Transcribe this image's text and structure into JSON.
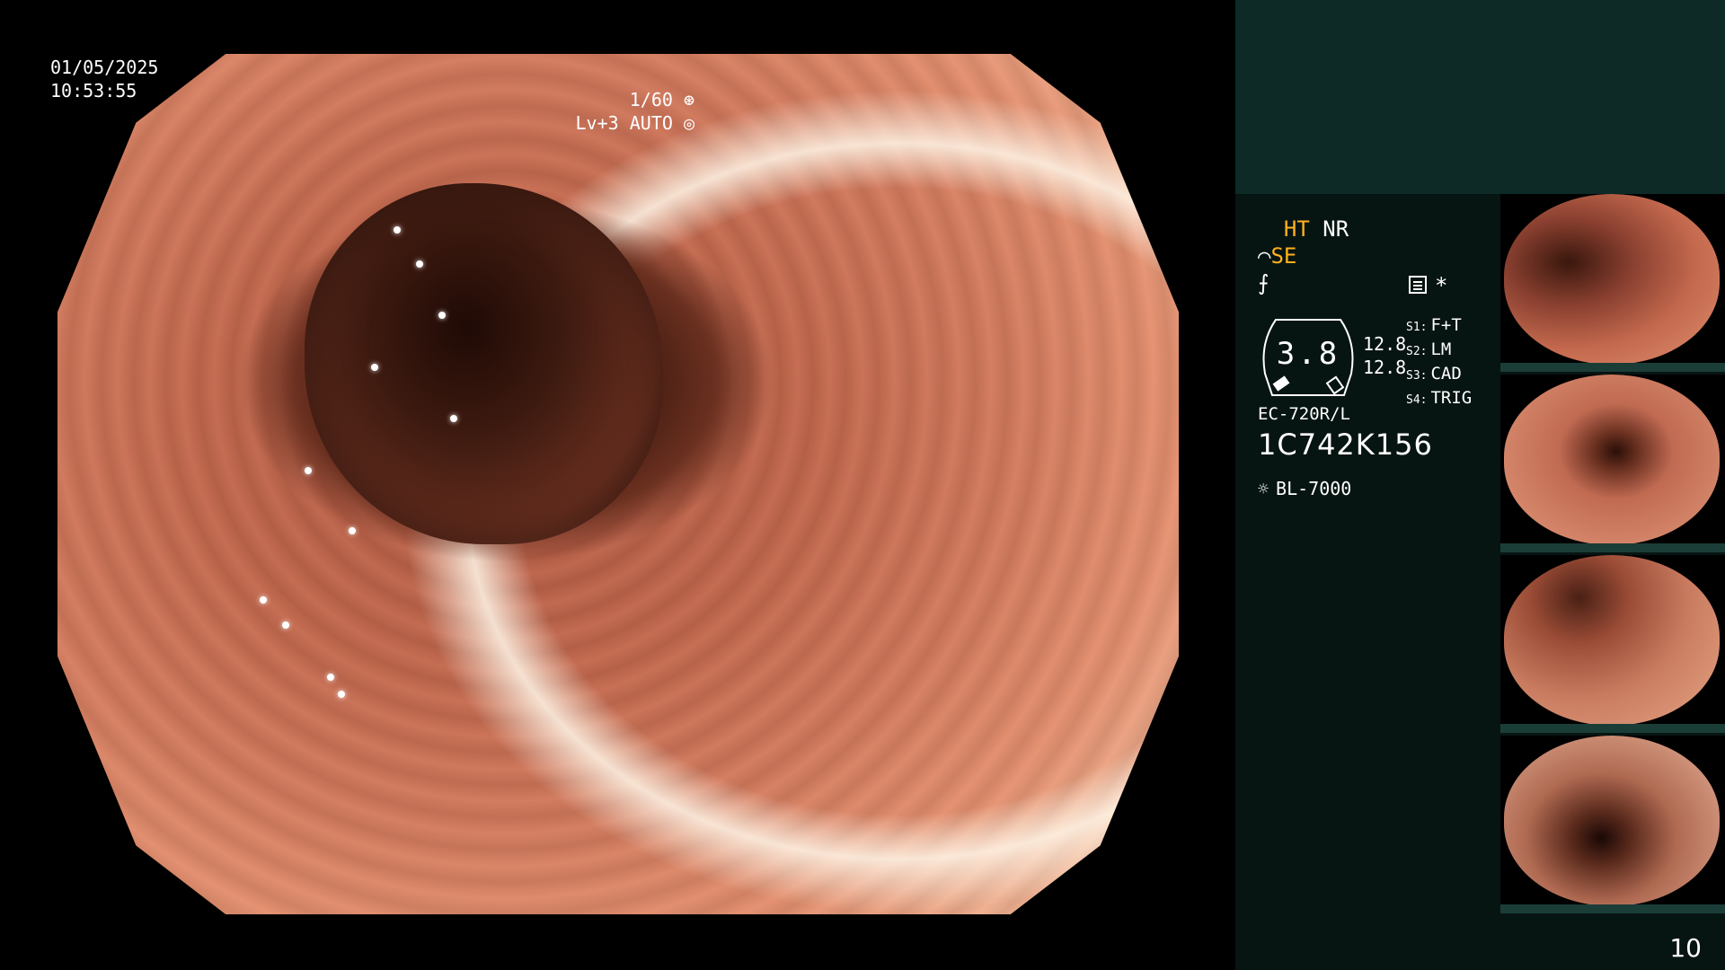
{
  "osd": {
    "date": "01/05/2025",
    "time": "10:53:55",
    "shutter": "1/60",
    "level": "Lv+3",
    "iris": "AUTO"
  },
  "side": {
    "mode_ht": "HT",
    "mode_nr": "NR",
    "mode_se": "SE",
    "dial_value": "3.8",
    "val_top": "12.8",
    "val_bottom": "12.8",
    "sources": [
      {
        "key": "S1:",
        "value": "F+T"
      },
      {
        "key": "S2:",
        "value": "LM"
      },
      {
        "key": "S3:",
        "value": "CAD"
      },
      {
        "key": "S4:",
        "value": "TRIG"
      }
    ],
    "asterisk": "*",
    "scope_model": "EC-720R/L",
    "serial": "1C742K156",
    "light_source": "BL-7000",
    "page_number": "10"
  },
  "colors": {
    "accent_yellow": "#ffb21e",
    "panel_dark": "#071512",
    "panel_top": "#0d2a26"
  },
  "icons": [
    "shutter-icon",
    "iris-icon",
    "scope-curve-icon",
    "freeze-icon",
    "settings-icon",
    "light-source-icon"
  ],
  "thumbnails": [
    {
      "label": "thumbnail-1"
    },
    {
      "label": "thumbnail-2"
    },
    {
      "label": "thumbnail-3"
    },
    {
      "label": "thumbnail-4"
    }
  ]
}
